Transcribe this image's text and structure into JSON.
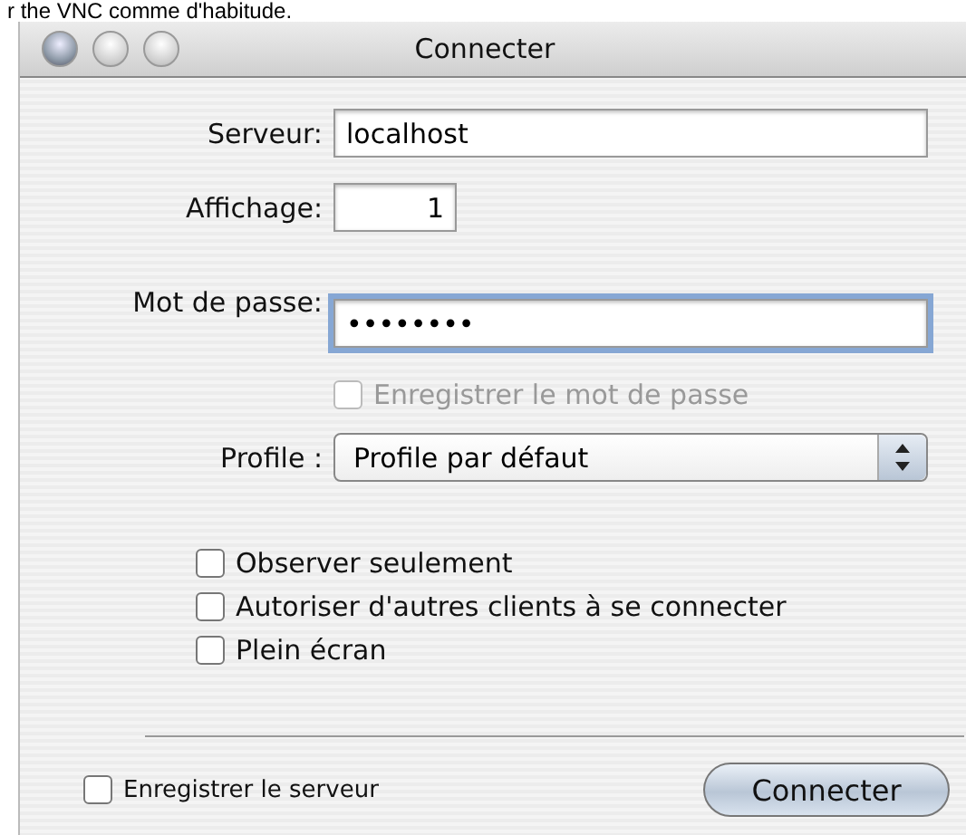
{
  "caption": "r the VNC comme d'habitude.",
  "window": {
    "title": "Connecter"
  },
  "fields": [
    {
      "kind": "text",
      "label": "Serveur:",
      "value": "localhost"
    },
    {
      "kind": "number",
      "label": "Affichage:",
      "value": "1"
    },
    {
      "kind": "password",
      "label": "Mot de passe:",
      "value": "••••••••"
    }
  ],
  "save_password": {
    "label": "Enregistrer le mot de passe",
    "checked": false,
    "disabled": true
  },
  "profile": {
    "label": "Profile :",
    "value": "Profile par défaut"
  },
  "options": [
    {
      "label": "Observer seulement",
      "checked": false
    },
    {
      "label": "Autoriser d'autres clients à se connecter",
      "checked": false
    },
    {
      "label": "Plein écran",
      "checked": false
    }
  ],
  "save_server": {
    "label": "Enregistrer le serveur",
    "checked": false
  },
  "buttons": [
    {
      "label": "Connecter"
    }
  ]
}
